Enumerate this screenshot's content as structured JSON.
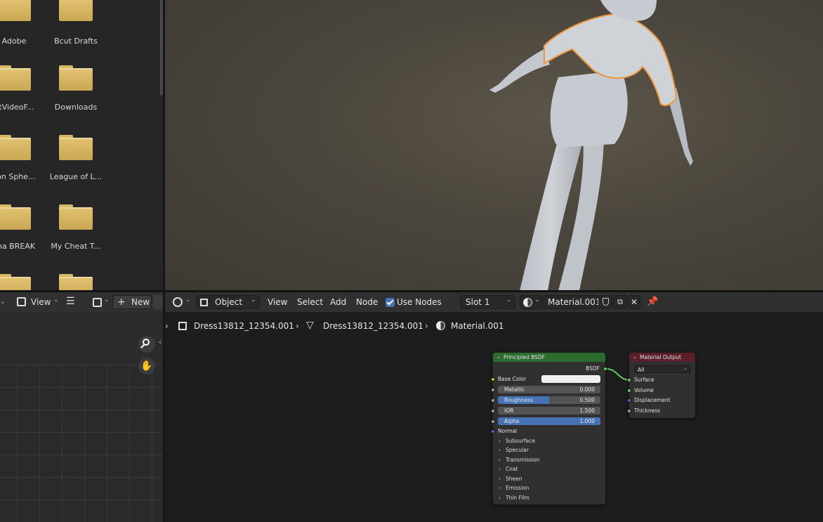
{
  "file_browser": {
    "folders": [
      {
        "label": "Adobe"
      },
      {
        "label": "Bcut Drafts"
      },
      {
        "label": "utVideoF..."
      },
      {
        "label": "Downloads"
      },
      {
        "label": "son Sphe..."
      },
      {
        "label": "League of L..."
      },
      {
        "label": "cha BREAK"
      },
      {
        "label": "My Cheat T..."
      },
      {
        "label": ""
      },
      {
        "label": ""
      }
    ]
  },
  "image_editor": {
    "header": {
      "view_label": "View",
      "new_label": "New"
    }
  },
  "node_editor": {
    "header": {
      "object_mode": "Object",
      "menus": [
        "View",
        "Select",
        "Add",
        "Node"
      ],
      "use_nodes_label": "Use Nodes",
      "use_nodes_checked": true,
      "slot": "Slot 1",
      "material_name": "Material.001"
    },
    "breadcrumb": {
      "object": "Dress13812_12354.001",
      "mesh": "Dress13812_12354.001",
      "material": "Material.001"
    },
    "principled_node": {
      "title": "Principled BSDF",
      "output_label": "BSDF",
      "base_color_label": "Base Color",
      "base_color_value": "#f0f0f0",
      "fields": [
        {
          "label": "Metallic",
          "value": "0.000",
          "fill": 0.0
        },
        {
          "label": "Roughness",
          "value": "0.500",
          "fill": 0.5
        },
        {
          "label": "IOR",
          "value": "1.500",
          "fill": 0.0
        },
        {
          "label": "Alpha",
          "value": "1.000",
          "fill": 1.0
        }
      ],
      "normal_label": "Normal",
      "panels": [
        "Subsurface",
        "Specular",
        "Transmission",
        "Coat",
        "Sheen",
        "Emission",
        "Thin Film"
      ]
    },
    "output_node": {
      "title": "Material Output",
      "target": "All",
      "inputs": [
        "Surface",
        "Volume",
        "Displacement",
        "Thickness"
      ]
    }
  },
  "colors": {
    "accent_blue": "#4772b3",
    "shader_header": "#2c6b2e",
    "output_header": "#5a1f2a",
    "socket_shader": "#63c763",
    "socket_color": "#c7c729",
    "socket_float": "#a1a1a1",
    "socket_vector": "#6363c7",
    "selection_outline": "#f0963c"
  }
}
